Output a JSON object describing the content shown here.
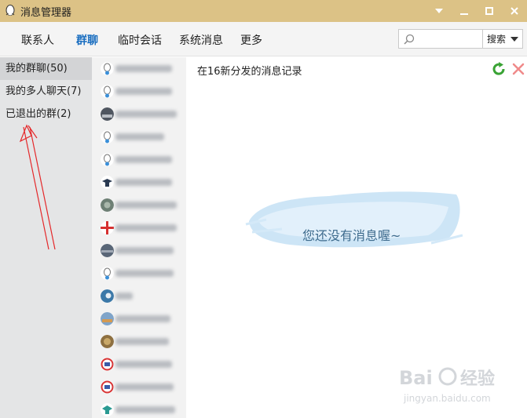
{
  "window": {
    "title": "消息管理器",
    "qq_icon": "qq-penguin-icon",
    "controls": [
      "dropdown-icon",
      "minimize-icon",
      "maximize-icon",
      "close-icon"
    ]
  },
  "nav": {
    "tabs": [
      {
        "label": "联系人",
        "active": false
      },
      {
        "label": "群聊",
        "active": true
      },
      {
        "label": "临时会话",
        "active": false
      },
      {
        "label": "系统消息",
        "active": false
      },
      {
        "label": "更多",
        "active": false
      }
    ],
    "search_placeholder": "",
    "search_button": "搜索"
  },
  "sidebar": {
    "items": [
      {
        "label": "我的群聊(50)",
        "selected": true
      },
      {
        "label": "我的多人聊天(7)",
        "selected": false
      },
      {
        "label": "已退出的群(2)",
        "selected": false
      }
    ]
  },
  "group_list": {
    "note": "",
    "items_count": 16
  },
  "content": {
    "record_title": "在16新分发的消息记录",
    "empty_message": "您还没有消息喔~"
  },
  "colors": {
    "titlebar": "#dcc286",
    "active_tab": "#1a6ec0",
    "sidebar_bg": "#e4e5e6",
    "grouplist_bg": "#f2f2f2",
    "annotation_red": "#e4282a"
  },
  "watermark": {
    "brand": "Baidu经验",
    "url": "jingyan.baidu.com"
  }
}
